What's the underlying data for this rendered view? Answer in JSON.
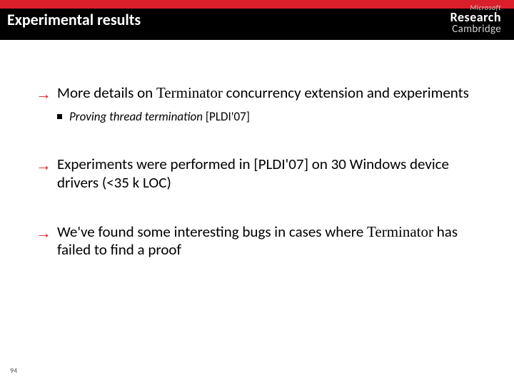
{
  "header": {
    "title": "Experimental results"
  },
  "logo": {
    "line1": "Microsoft",
    "line2": "Research",
    "line3": "Cambridge"
  },
  "bullets": [
    {
      "prefix": "More details on ",
      "tool": "Terminator",
      "suffix": " concurrency extension and experiments",
      "sub_italic": "Proving thread termination",
      "sub_plain": " [PLDI'07]"
    },
    {
      "text": "Experiments were performed in [PLDI'07] on 30 Windows device drivers (<35 k LOC)"
    },
    {
      "prefix": "We've found some interesting bugs in cases where ",
      "tool": "Terminator",
      "suffix": " has failed to find a proof"
    }
  ],
  "page_number": "94"
}
